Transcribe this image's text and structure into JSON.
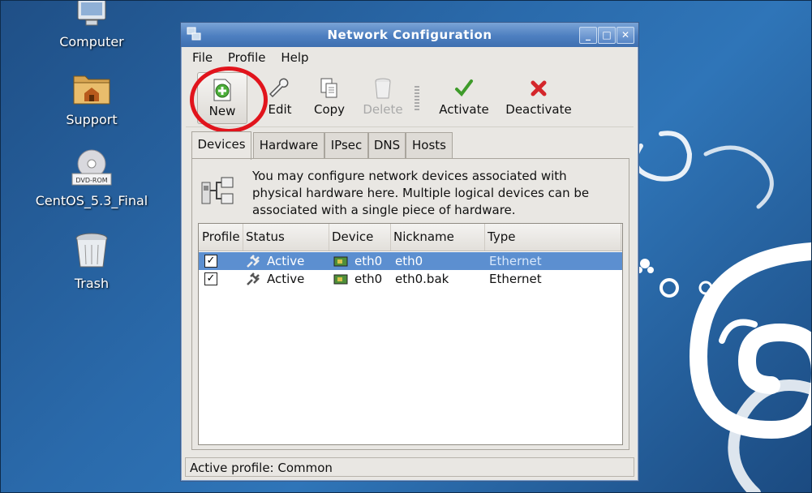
{
  "desktop": {
    "icons": [
      {
        "label": "Computer",
        "icon": "computer-icon"
      },
      {
        "label": "Support",
        "icon": "folder-icon"
      },
      {
        "label": "CentOS_5.3_Final",
        "icon": "dvd-rom-icon",
        "badge": "DVD-ROM"
      },
      {
        "label": "Trash",
        "icon": "trash-icon"
      }
    ]
  },
  "window": {
    "title": "Network Configuration",
    "menu": [
      "File",
      "Profile",
      "Help"
    ],
    "toolbar": {
      "new": "New",
      "edit": "Edit",
      "copy": "Copy",
      "delete": "Delete",
      "activate": "Activate",
      "deactivate": "Deactivate"
    },
    "tabs": [
      "Devices",
      "Hardware",
      "IPsec",
      "DNS",
      "Hosts"
    ],
    "active_tab": "Devices",
    "info_text": "You may configure network devices associated with physical hardware here.  Multiple logical devices can be associated with a single piece of hardware.",
    "table": {
      "columns": [
        "Profile",
        "Status",
        "Device",
        "Nickname",
        "Type"
      ],
      "rows": [
        {
          "checked": "✓",
          "status": "Active",
          "device": "eth0",
          "nickname": "eth0",
          "type": "Ethernet"
        },
        {
          "checked": "✓",
          "status": "Active",
          "device": "eth0",
          "nickname": "eth0.bak",
          "type": "Ethernet"
        }
      ]
    },
    "statusbar": "Active profile: Common"
  },
  "colors": {
    "desktop_bg": "#2a6aab",
    "titlebar": "#4d7fc0",
    "selection": "#5c8fd0",
    "highlight_circle": "#e1141c"
  }
}
